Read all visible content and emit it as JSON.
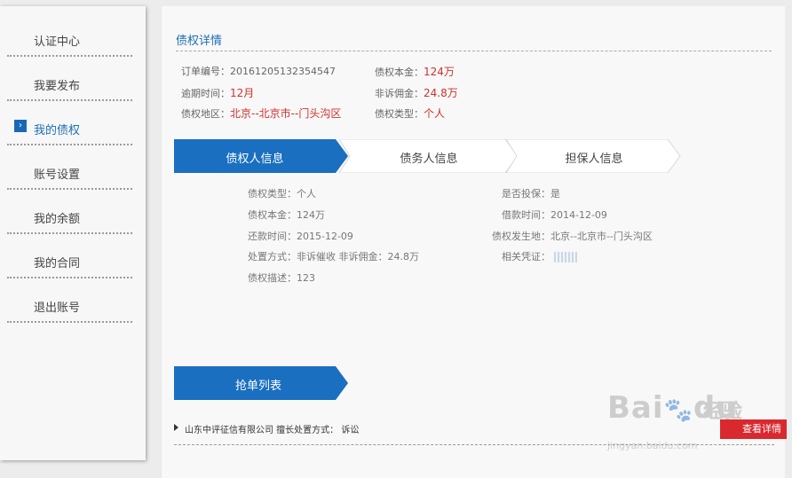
{
  "sidebar": {
    "items": [
      {
        "label": "认证中心"
      },
      {
        "label": "我要发布"
      },
      {
        "label": "我的债权",
        "active": true
      },
      {
        "label": "账号设置"
      },
      {
        "label": "我的余额"
      },
      {
        "label": "我的合同"
      },
      {
        "label": "退出账号"
      }
    ],
    "active_marker": "›"
  },
  "main": {
    "section_title": "债权详情",
    "summary": {
      "order_no_label": "订单编号：",
      "order_no_value": "20161205132354547",
      "overdue_label": "逾期时间：",
      "overdue_value": "12月",
      "region_label": "债权地区：",
      "region_value": "北京--北京市--门头沟区",
      "principal_label": "债权本金：",
      "principal_value": "124万",
      "commission_label": "非诉佣金：",
      "commission_value": "24.8万",
      "type_label": "债权类型：",
      "type_value": "个人"
    },
    "tabs": [
      {
        "label": "债权人信息",
        "active": true
      },
      {
        "label": "债务人信息"
      },
      {
        "label": "担保人信息"
      }
    ],
    "details": {
      "type": "债权类型：个人",
      "principal": "债权本金：124万",
      "repay": "还款时间：2015-12-09",
      "method": "处置方式：非诉催收 非诉佣金：24.8万",
      "desc": "债权描述：123",
      "guarantee": "是否投保：是",
      "borrow": "借款时间：2014-12-09",
      "place": "债权发生地：北京--北京市--门头沟区",
      "evidence": "相关凭证："
    },
    "grab": {
      "label": "抢单列表",
      "row_text": "山东中评征信有限公司 擅长处置方式： 诉讼",
      "detail_button": "查看详情"
    }
  },
  "watermark": {
    "brand": "Bai",
    "brand2": "du",
    "cn": "经验",
    "url": "jingyan.baidu.com"
  },
  "colors": {
    "accent": "#1a6fc0",
    "link": "#1c6fb5",
    "highlight": "#d0302c",
    "button": "#d9282e"
  }
}
